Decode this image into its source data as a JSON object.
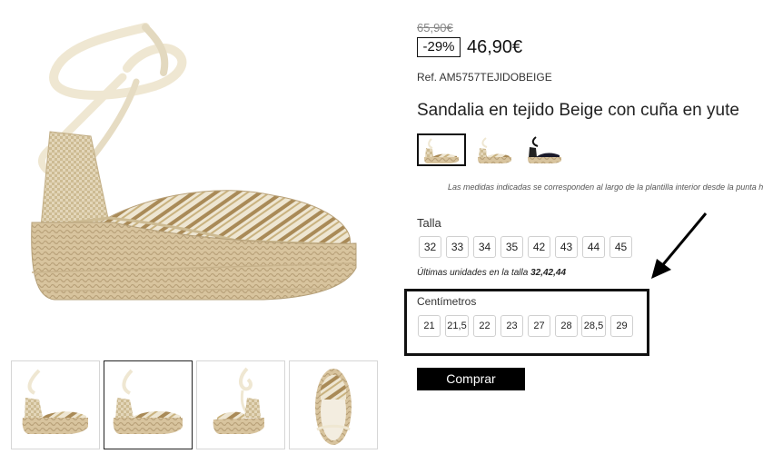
{
  "pricing": {
    "old_price": "65,90€",
    "discount": "-29%",
    "price": "46,90€"
  },
  "product": {
    "reference": "Ref. AM5757TEJIDOBEIGE",
    "title": "Sandalia en tejido Beige con cuña en yute"
  },
  "colors": {
    "swatches": [
      {
        "name": "beige",
        "selected": true
      },
      {
        "name": "beige-alt",
        "selected": false
      },
      {
        "name": "black",
        "selected": false
      }
    ]
  },
  "measure_note": "Las medidas indicadas se corresponden al largo de la plantilla interior desde la punta has",
  "sizes": {
    "label": "Talla",
    "options": [
      "32",
      "33",
      "34",
      "35",
      "42",
      "43",
      "44",
      "45"
    ]
  },
  "last_units": {
    "prefix": "Últimas unidades en la talla",
    "sizes": "32,42,44"
  },
  "centimeters": {
    "label": "Centímetros",
    "options": [
      "21",
      "21,5",
      "22",
      "23",
      "27",
      "28",
      "28,5",
      "29"
    ]
  },
  "actions": {
    "buy_label": "Comprar"
  },
  "gallery": {
    "thumbnails": [
      {
        "view": "side",
        "active": false
      },
      {
        "view": "side-alt",
        "active": true
      },
      {
        "view": "back",
        "active": false
      },
      {
        "view": "top",
        "active": false
      }
    ]
  },
  "theme": {
    "accent": "#000000",
    "rope": "#d9c5a0",
    "ribbon": "#efe7d2",
    "stripe_brown": "#a98a57",
    "canvas_beige": "#e8dcc2"
  }
}
